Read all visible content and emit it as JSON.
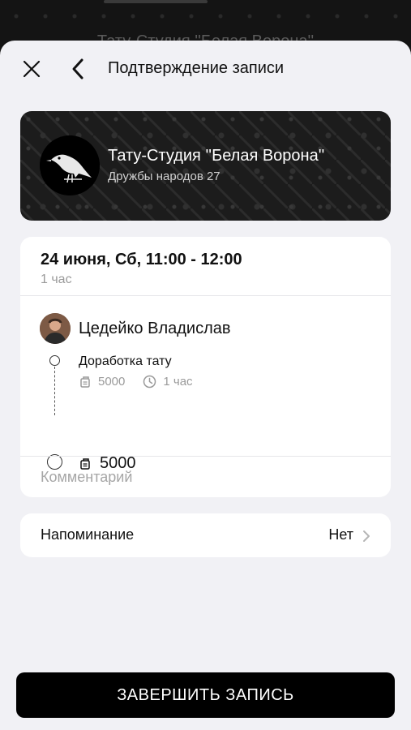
{
  "backdrop": {
    "title": "Тату-Студия ''Белая Ворона''"
  },
  "header": {
    "title": "Подтверждение записи",
    "close_icon": "close-icon",
    "back_icon": "chevron-left-icon"
  },
  "studio": {
    "name": "Тату-Студия ''Белая Ворона''",
    "address": "Дружбы народов 27",
    "logo_icon": "crow-logo"
  },
  "appointment": {
    "date_time": "24 июня, Сб, 11:00 - 12:00",
    "duration": "1 час",
    "master": {
      "name": "Цедейко Владислав"
    },
    "service": {
      "name": "Доработка тату",
      "price": "5000",
      "duration": "1 час"
    },
    "total": "5000"
  },
  "comment": {
    "placeholder": "Комментарий",
    "value": ""
  },
  "reminder": {
    "label": "Напоминание",
    "value": "Нет"
  },
  "submit": {
    "label": "ЗАВЕРШИТЬ ЗАПИСЬ"
  },
  "colors": {
    "accent": "#000000",
    "background": "#f1f1f5",
    "muted_text": "#9a9a9a"
  }
}
